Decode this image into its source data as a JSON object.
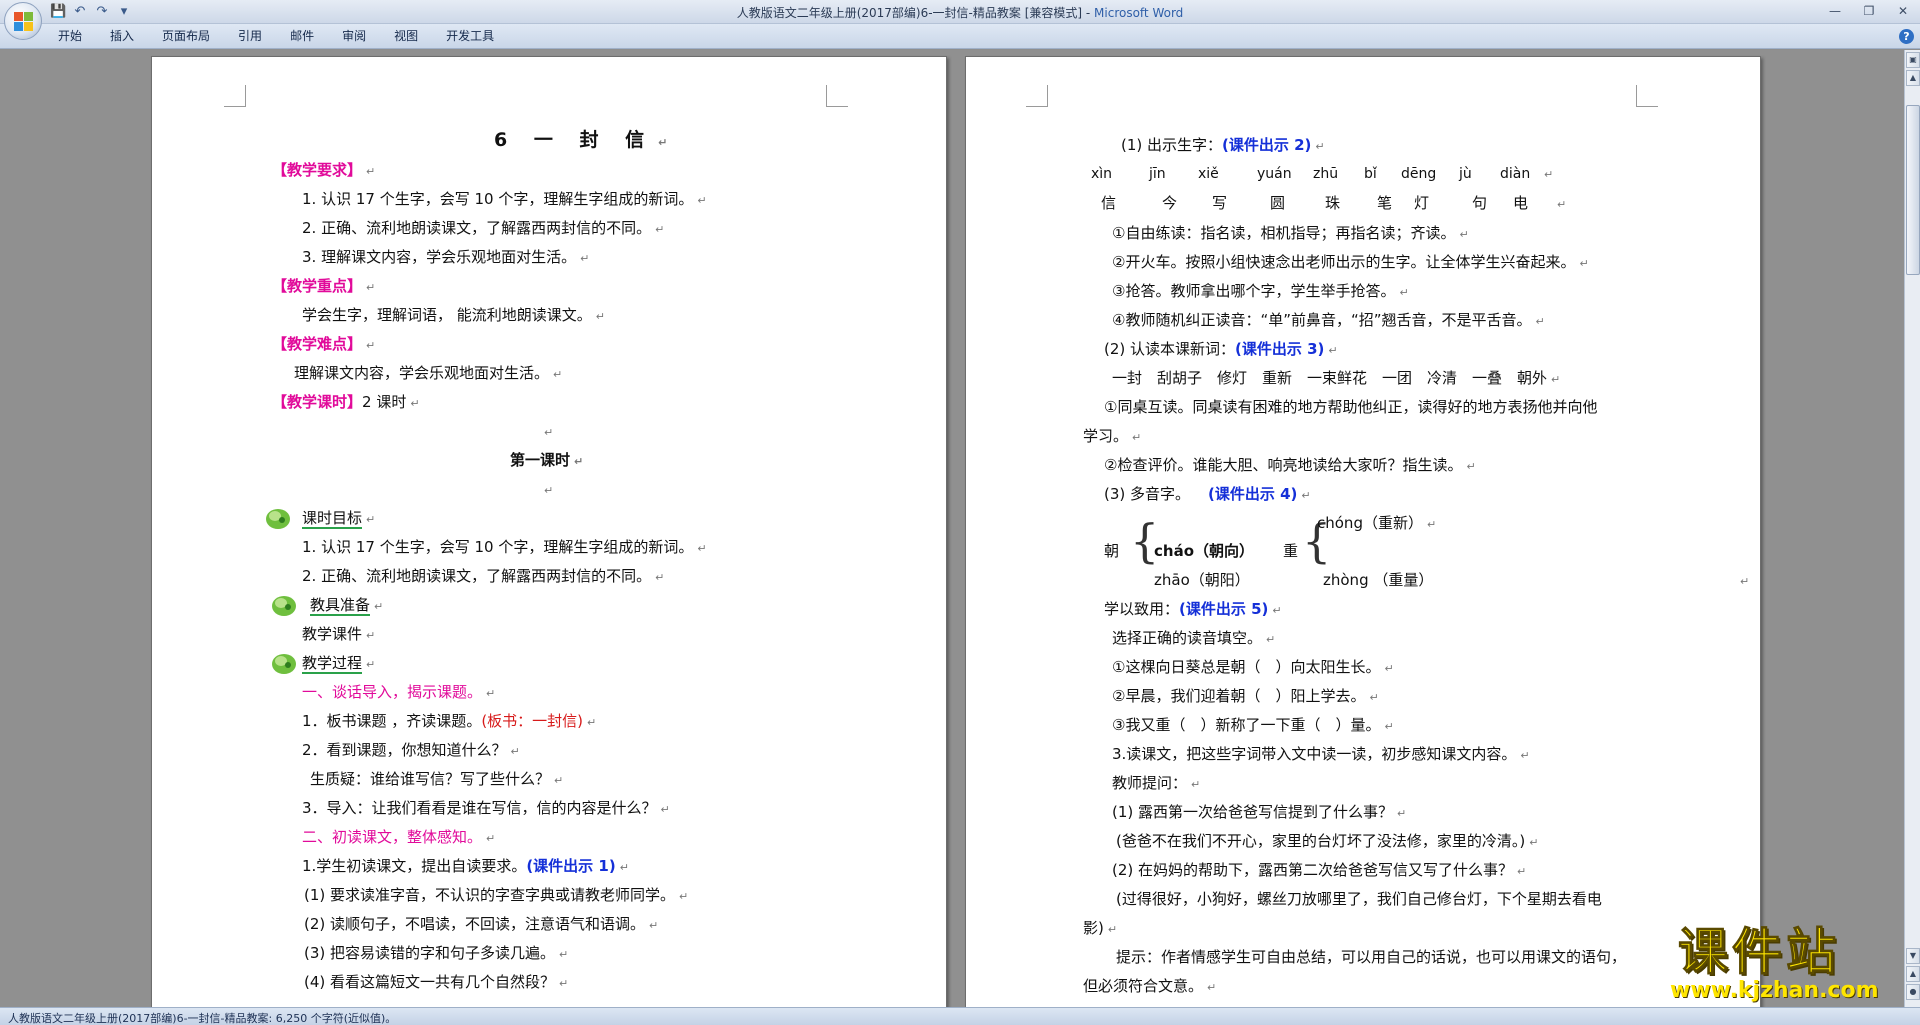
{
  "window": {
    "title_doc": "人教版语文二年级上册(2017部编)6-一封信-精品教案 [兼容模式] - ",
    "title_app": "Microsoft Word"
  },
  "ribbon": {
    "tabs": [
      "开始",
      "插入",
      "页面布局",
      "引用",
      "邮件",
      "审阅",
      "视图",
      "开发工具"
    ]
  },
  "left_page": {
    "title": "6 一 封 信",
    "req_heading": "【教学要求】",
    "req": [
      "1. 认识 17 个生字，会写 10 个字，理解生字组成的新词。",
      "2. 正确、流利地朗读课文，了解露西两封信的不同。",
      "3. 理解课文内容，学会乐观地面对生活。"
    ],
    "key_heading": "【教学重点】",
    "key_text": "学会生字，理解词语， 能流利地朗读课文。",
    "diff_heading": "【教学难点】",
    "diff_text": "理解课文内容，学会乐观地面对生活。",
    "hours_heading": "【教学课时】",
    "hours_text": "2 课时",
    "lesson1": "第一课时",
    "goal_heading": "课时目标",
    "goals": [
      "1. 认识 17 个生字，会写 10 个字，理解生字组成的新词。",
      "2. 正确、流利地朗读课文，了解露西两封信的不同。"
    ],
    "prep_heading": "教具准备",
    "prep_text": "教学课件",
    "process_heading": "教学过程",
    "step1": "一、谈话导入，揭示课题。",
    "s1_1a": "1．板书课题 ，齐读课题。",
    "s1_1b": "(板书：一封信)",
    "s1_2": "2．看到课题，你想知道什么？",
    "s1_q": "生质疑：谁给谁写信？写了些什么？",
    "s1_3": "3．导入：让我们看看是谁在写信，信的内容是什么？",
    "step2": "二、初读课文，整体感知。",
    "s2_1a": "1.学生初读课文，提出自读要求。",
    "s2_1b": "(课件出示 1)",
    "s2_items": [
      "(1) 要求读准字音，不认识的字查字典或请教老师同学。",
      "(2) 读顺句子，不唱读，不回读，注意语气和语调。",
      "(3) 把容易读错的字和句子多读几遍。",
      "(4) 看看这篇短文一共有几个自然段？"
    ]
  },
  "right_page": {
    "r1a": "(1) 出示生字：",
    "r1b": "(课件出示 2)",
    "pinyin": [
      "xìn",
      "jīn",
      "xiě",
      "yuán",
      "zhū",
      "bǐ",
      "dēng",
      "jù",
      "diàn"
    ],
    "chars": [
      "信",
      "今",
      "写",
      "圆",
      "珠",
      "笔",
      "灯",
      "句",
      "电"
    ],
    "r2": "①自由练读：指名读，相机指导；再指名读；齐读。",
    "r3": "②开火车。按照小组快速念出老师出示的生字。让全体学生兴奋起来。",
    "r4": "③抢答。教师拿出哪个字，学生举手抢答。",
    "r5": "④教师随机纠正读音：“单”前鼻音，“招”翘舌音，不是平舌音。",
    "r6a": "(2) 认读本课新词：",
    "r6b": "(课件出示 3)",
    "r7": "一封　刮胡子　修灯　重新　一束鲜花　一团　冷清　一叠　朝外",
    "r8": "①同桌互读。同桌读有困难的地方帮助他纠正，读得好的地方表扬他并向他",
    "r8b": "学习。",
    "r9": "②检查评价。谁能大胆、响亮地读给大家听？指生读。",
    "r10a": "(3) 多音字。",
    "r10b": "(课件出示 4)",
    "poly": {
      "c1": "朝",
      "c1_a": "cháo（朝向）",
      "c1_b": "zhāo（朝阳）",
      "c2": "重",
      "c2_a": "chóng（重新）",
      "c2_b": "zhòng （重量）"
    },
    "r11a": "学以致用：",
    "r11b": "(课件出示 5)",
    "r12": "选择正确的读音填空。",
    "r13": "①这棵向日葵总是朝（　）向太阳生长。",
    "r14": "②早晨，我们迎着朝（　）阳上学去。",
    "r15": "③我又重（　）新称了一下重（　）量。",
    "r16": "3.读课文，把这些字词带入文中读一读，初步感知课文内容。",
    "r17": "教师提问：",
    "r18": "(1) 露西第一次给爸爸写信提到了什么事？",
    "r19": "(爸爸不在我们不开心，家里的台灯坏了没法修，家里的冷清。)",
    "r20": "(2) 在妈妈的帮助下，露西第二次给爸爸写信又写了什么事？",
    "r21": "(过得很好，小狗好，螺丝刀放哪里了，我们自己修台灯，下个星期去看电",
    "r21b": "影)",
    "r22": "提示：作者情感学生可自由总结，可以用自己的话说，也可以用课文的语句，",
    "r22b": "但必须符合文意。"
  },
  "status": {
    "text": "人教版语文二年级上册(2017部编)6-一封信-精品教案: 6,250 个字符(近似值)。"
  },
  "watermark": {
    "main": "课件站",
    "url": "www.kjzhan.com"
  },
  "colors": {
    "heading_magenta": "#e10a9a",
    "board_red": "#d71a1a",
    "courseware_blue": "#1530d8",
    "underline_green": "#2aa14a"
  }
}
